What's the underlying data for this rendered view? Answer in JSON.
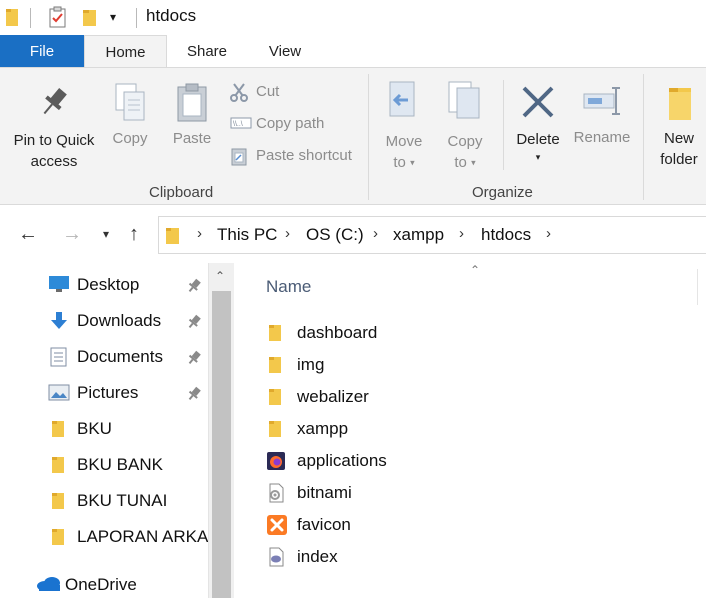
{
  "window": {
    "title": "htdocs"
  },
  "tabs": {
    "file": "File",
    "home": "Home",
    "share": "Share",
    "view": "View"
  },
  "ribbon": {
    "pin": "Pin to Quick",
    "pin2": "access",
    "copy": "Copy",
    "paste": "Paste",
    "cut": "Cut",
    "copy_path": "Copy path",
    "paste_shortcut": "Paste shortcut",
    "clipboard": "Clipboard",
    "move": "Move",
    "move2": "to",
    "copyto": "Copy",
    "copyto2": "to",
    "delete": "Delete",
    "rename": "Rename",
    "organize": "Organize",
    "newfolder": "New",
    "newfolder2": "folder"
  },
  "address": {
    "crumbs": [
      "This PC",
      "OS (C:)",
      "xampp",
      "htdocs"
    ]
  },
  "sidebar": {
    "items": [
      {
        "label": "Desktop",
        "icon": "desktop-icon",
        "pinned": true
      },
      {
        "label": "Downloads",
        "icon": "download-icon",
        "pinned": true
      },
      {
        "label": "Documents",
        "icon": "documents-icon",
        "pinned": true
      },
      {
        "label": "Pictures",
        "icon": "pictures-icon",
        "pinned": true
      },
      {
        "label": "BKU",
        "icon": "folder-icon",
        "pinned": false
      },
      {
        "label": "BKU BANK",
        "icon": "folder-icon",
        "pinned": false
      },
      {
        "label": "BKU TUNAI",
        "icon": "folder-icon",
        "pinned": false
      },
      {
        "label": "LAPORAN ARKA",
        "icon": "folder-icon",
        "pinned": false
      },
      {
        "label": "OneDrive",
        "icon": "cloud-icon",
        "pinned": false
      }
    ]
  },
  "content": {
    "column_name": "Name",
    "files": [
      {
        "name": "dashboard",
        "icon": "folder-icon"
      },
      {
        "name": "img",
        "icon": "folder-icon"
      },
      {
        "name": "webalizer",
        "icon": "folder-icon"
      },
      {
        "name": "xampp",
        "icon": "folder-icon"
      },
      {
        "name": "applications",
        "icon": "firefox-html-icon"
      },
      {
        "name": "bitnami",
        "icon": "css-file-icon"
      },
      {
        "name": "favicon",
        "icon": "xampp-icon"
      },
      {
        "name": "index",
        "icon": "php-file-icon"
      }
    ]
  },
  "colors": {
    "accent": "#1a6fc4",
    "folder": "#f3c84b",
    "ribbon_bg": "#f3f3f3"
  }
}
